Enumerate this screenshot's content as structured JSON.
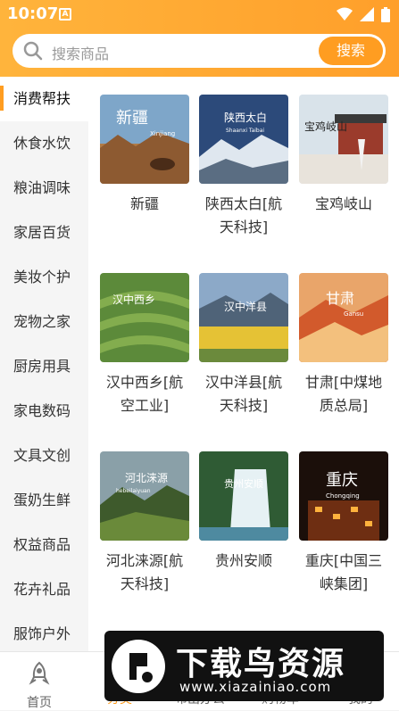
{
  "status_bar": {
    "time": "10:07",
    "app_icon_letter": "A"
  },
  "search": {
    "placeholder": "搜索商品",
    "button": "搜索"
  },
  "sidebar": {
    "items": [
      {
        "label": "消费帮扶",
        "active": true
      },
      {
        "label": "休食水饮"
      },
      {
        "label": "粮油调味"
      },
      {
        "label": "家居百货"
      },
      {
        "label": "美妆个护"
      },
      {
        "label": "宠物之家"
      },
      {
        "label": "厨房用具"
      },
      {
        "label": "家电数码"
      },
      {
        "label": "文具文创"
      },
      {
        "label": "蛋奶生鲜"
      },
      {
        "label": "权益商品"
      },
      {
        "label": "花卉礼品"
      },
      {
        "label": "服饰户外"
      }
    ]
  },
  "grid": {
    "items": [
      {
        "name": "新疆",
        "badge": "新疆",
        "badge_sub": "Xinjiang"
      },
      {
        "name": "陕西太白[航天科技]",
        "badge": "陕西太白",
        "badge_sub": "Shaanxi Taibai"
      },
      {
        "name": "宝鸡岐山",
        "badge": "宝鸡岐山",
        "badge_sub": ""
      },
      {
        "name": "汉中西乡[航空工业]",
        "badge": "汉中西乡",
        "badge_sub": ""
      },
      {
        "name": "汉中洋县[航天科技]",
        "badge": "汉中洋县",
        "badge_sub": ""
      },
      {
        "name": "甘肃[中煤地质总局]",
        "badge": "甘肃",
        "badge_sub": "Gansu"
      },
      {
        "name": "河北涞源[航天科技]",
        "badge": "河北涞源",
        "badge_sub": "hebeilaiyuan"
      },
      {
        "name": "贵州安顺",
        "badge": "贵州安顺",
        "badge_sub": ""
      },
      {
        "name": "重庆[中国三峡集团]",
        "badge": "重庆",
        "badge_sub": "Chongqing"
      }
    ]
  },
  "bottom_nav": {
    "items": [
      {
        "label": "首页"
      },
      {
        "label": "分类"
      },
      {
        "label": "布出办公"
      },
      {
        "label": "购物车"
      },
      {
        "label": "我的"
      }
    ]
  },
  "watermark": {
    "title": "下载鸟资源",
    "url": "www.xiazainiao.com"
  },
  "colors": {
    "accent": "#ff9d21",
    "header_start": "#ffb43c",
    "header_end": "#ff9f2a"
  }
}
